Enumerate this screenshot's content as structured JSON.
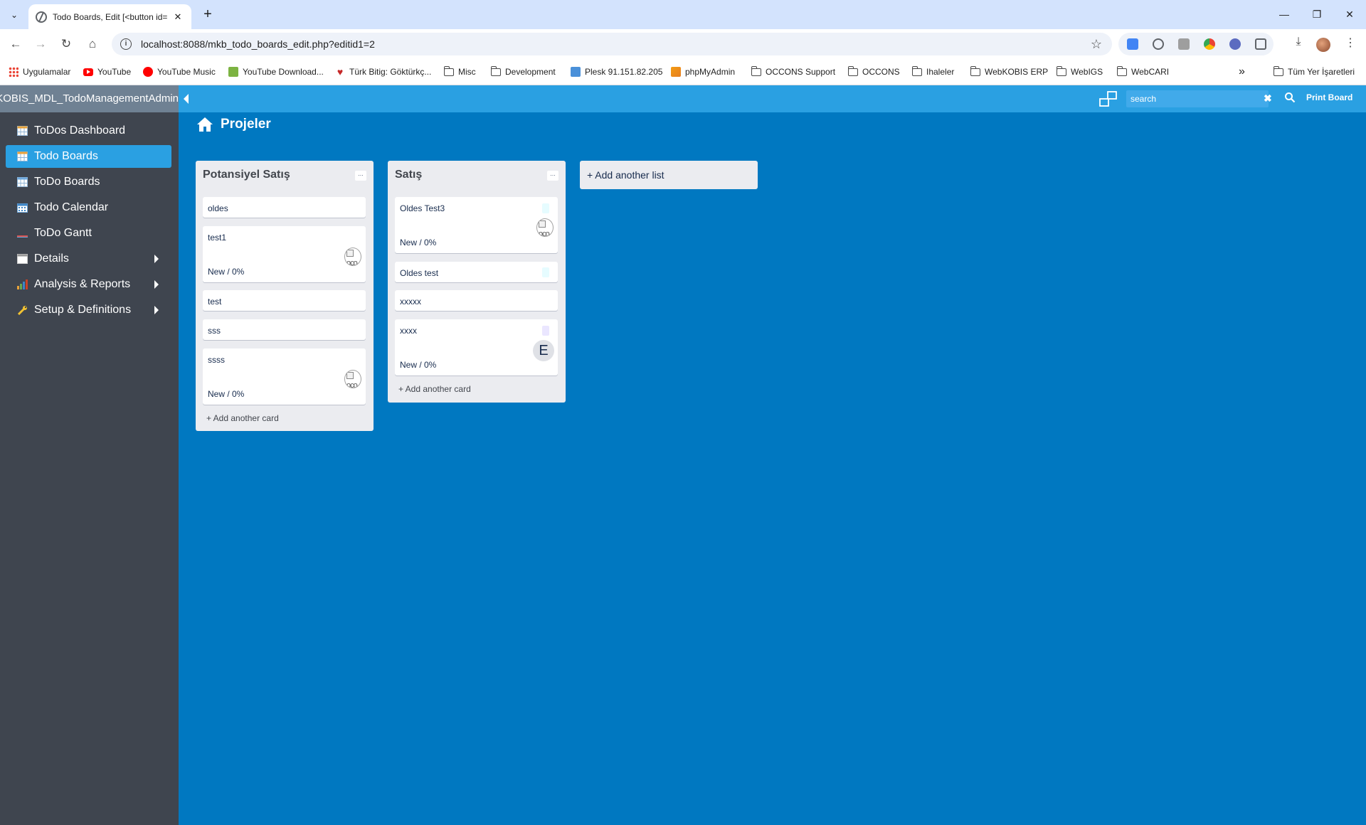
{
  "browser": {
    "tab_title": "Todo Boards, Edit [<button id=",
    "tab_close": "✕",
    "new_tab": "+",
    "tab_search": "⌄",
    "url": "localhost:8088/mkb_todo_boards_edit.php?editid1=2",
    "window": {
      "minimize": "—",
      "restore": "❐",
      "close": "✕"
    },
    "nav": {
      "back": "←",
      "forward": "→",
      "reload": "↻",
      "home": "⌂"
    },
    "info_icon": "i",
    "star_icon": "☆",
    "download_icon": "⤓",
    "menu_icon": "⋮",
    "bookmarks": [
      {
        "label": "Uygulamalar",
        "icon": "apps-icon"
      },
      {
        "label": "YouTube",
        "icon": "youtube-icon"
      },
      {
        "label": "YouTube Music",
        "icon": "youtube-music-icon"
      },
      {
        "label": "YouTube Download...",
        "icon": "download-app-icon"
      },
      {
        "label": "Türk Bitig: Göktürkç...",
        "icon": "turk-bitig-icon"
      },
      {
        "label": "Misc",
        "icon": "folder-icon"
      },
      {
        "label": "Development",
        "icon": "folder-icon"
      },
      {
        "label": "Plesk 91.151.82.205",
        "icon": "plesk-icon"
      },
      {
        "label": "phpMyAdmin",
        "icon": "phpmyadmin-icon"
      },
      {
        "label": "OCCONS Support",
        "icon": "folder-icon"
      },
      {
        "label": "OCCONS",
        "icon": "folder-icon"
      },
      {
        "label": "Ihaleler",
        "icon": "folder-icon"
      },
      {
        "label": "WebKOBIS ERP",
        "icon": "folder-icon"
      },
      {
        "label": "WebIGS",
        "icon": "folder-icon"
      },
      {
        "label": "WebCARI",
        "icon": "folder-icon"
      }
    ],
    "bookmarks_overflow": "»",
    "all_bookmarks": "Tüm Yer İşaretleri"
  },
  "app": {
    "title": "WebKOBIS_MDL_TodoManagementAdmin",
    "search_placeholder": "search",
    "search_clear": "✖",
    "print_board": "Print Board",
    "sidebar": [
      {
        "label": "ToDos Dashboard",
        "active": false,
        "has_submenu": false
      },
      {
        "label": "Todo Boards",
        "active": true,
        "has_submenu": false
      },
      {
        "label": "ToDo Boards",
        "active": false,
        "has_submenu": false
      },
      {
        "label": "Todo Calendar",
        "active": false,
        "has_submenu": false
      },
      {
        "label": "ToDo Gantt",
        "active": false,
        "has_submenu": false
      },
      {
        "label": "Details",
        "active": false,
        "has_submenu": true
      },
      {
        "label": "Analysis & Reports",
        "active": false,
        "has_submenu": true
      },
      {
        "label": "Setup & Definitions",
        "active": false,
        "has_submenu": true
      }
    ],
    "board_title": "Projeler",
    "lists": [
      {
        "title": "Potansiyel Satış",
        "menu": "...",
        "cards": [
          {
            "title": "oldes"
          },
          {
            "title": "test1",
            "status": "New / 0%",
            "image_alt": "oco"
          },
          {
            "title": "test"
          },
          {
            "title": "sss"
          },
          {
            "title": "ssss",
            "status": "New / 0%",
            "image_alt": "oco"
          }
        ],
        "add_card": "+ Add another card"
      },
      {
        "title": "Satış",
        "menu": "...",
        "cards": [
          {
            "title": "Oldes Test3",
            "status": "New / 0%",
            "image_alt": "oco",
            "tag_color": "#e6fcff"
          },
          {
            "title": "Oldes test",
            "tag_color": "#e6fcff"
          },
          {
            "title": "xxxxx"
          },
          {
            "title": "xxxx",
            "status": "New / 0%",
            "avatar_letter": "E",
            "tag_color": "#eae6ff"
          }
        ],
        "add_card": "+ Add another card"
      }
    ],
    "add_list": "+ Add another list"
  },
  "colors": {
    "app_background": "#0078c1",
    "topbar": "#2aa0e2",
    "sidebar": "#3f454f",
    "sidebar_active": "#2aa0e2",
    "list_background": "#ebecf0"
  }
}
